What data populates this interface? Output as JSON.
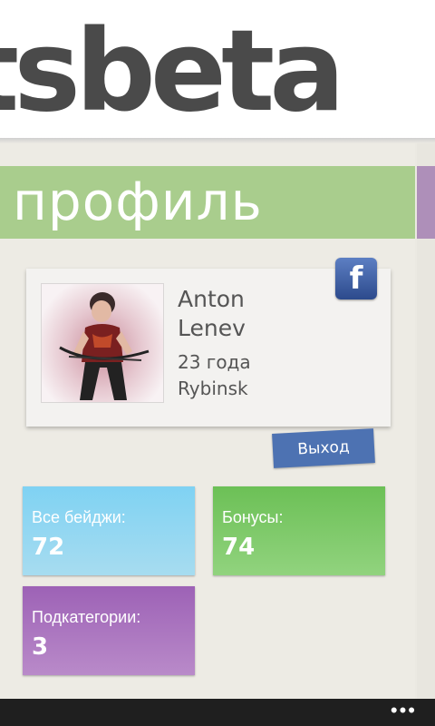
{
  "app": {
    "title": "tsbeta"
  },
  "section": {
    "title": "профиль"
  },
  "profile": {
    "name": "Anton Lenev",
    "age": "23 года",
    "city": "Rybinsk",
    "avatar_icon": "person-with-bow-photo",
    "facebook_icon": "facebook-icon",
    "facebook_label": "f"
  },
  "logout": {
    "label": "Выход"
  },
  "tiles": [
    {
      "label": "Все бейджи:",
      "value": "72",
      "color": "#8fd6f2"
    },
    {
      "label": "Бонусы:",
      "value": "74",
      "color": "#7dc96a"
    },
    {
      "label": "Подкатегории:",
      "value": "3",
      "color": "#a874bf"
    }
  ],
  "app_bar": {
    "more_label": "•••"
  },
  "colors": {
    "section_bar": "#a9cd8d",
    "next_section": "#ae8fb9",
    "logout_button": "#4d72b2",
    "background": "#edebe4"
  }
}
